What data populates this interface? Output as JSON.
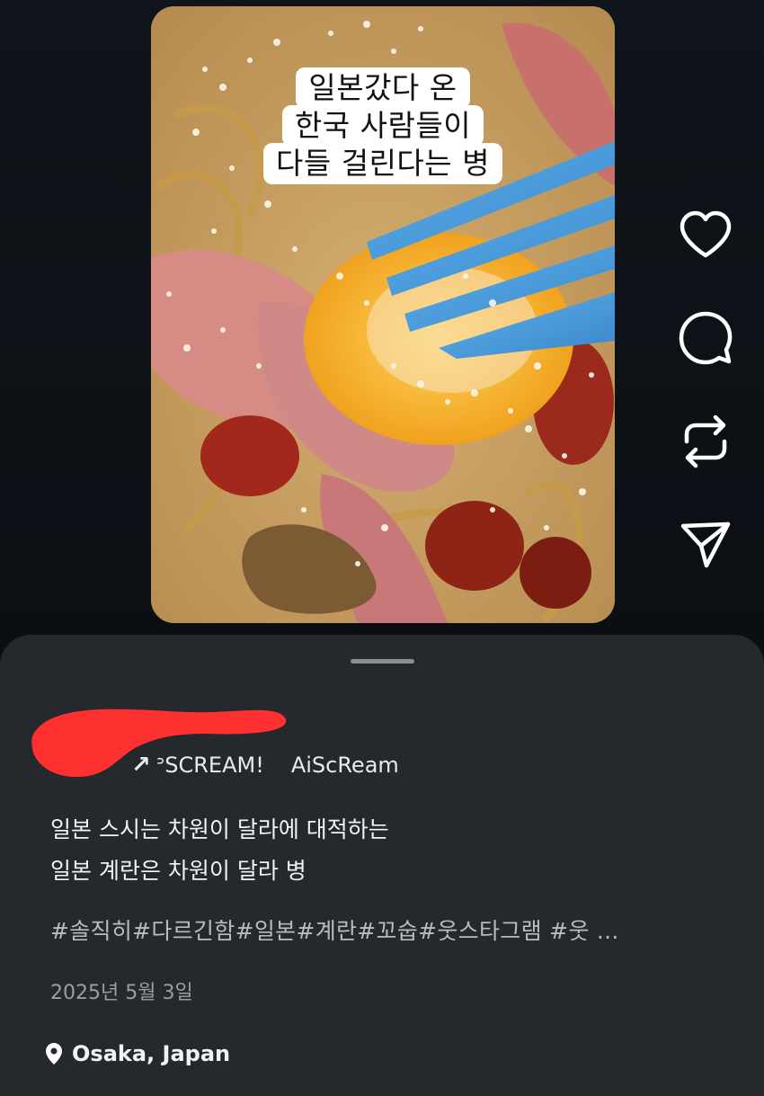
{
  "video": {
    "caption_lines": [
      "일본갔다 온",
      "한국 사람들이",
      "다들 걸린다는 병"
    ]
  },
  "actions": {
    "like_icon": "heart-icon",
    "comment_icon": "comment-icon",
    "repost_icon": "repost-icon",
    "share_icon": "send-icon"
  },
  "post": {
    "music": {
      "prefix": "↗",
      "title": "ᐣSCREAM!",
      "artist": "AiScReam"
    },
    "description_lines": [
      "일본 스시는 차원이 달라에 대적하는",
      "일본 계란은 차원이 달라 병"
    ],
    "hashtags": "#솔직히#다르긴함#일본#계란#꼬숩#웃스타그램 #웃 ...",
    "date": "2025년 5월 3일",
    "location": "Osaka, Japan"
  },
  "colors": {
    "background": "#0b0f14",
    "sheet": "#25282d",
    "redaction": "#ff3030",
    "fork": "#4f9fe0"
  }
}
